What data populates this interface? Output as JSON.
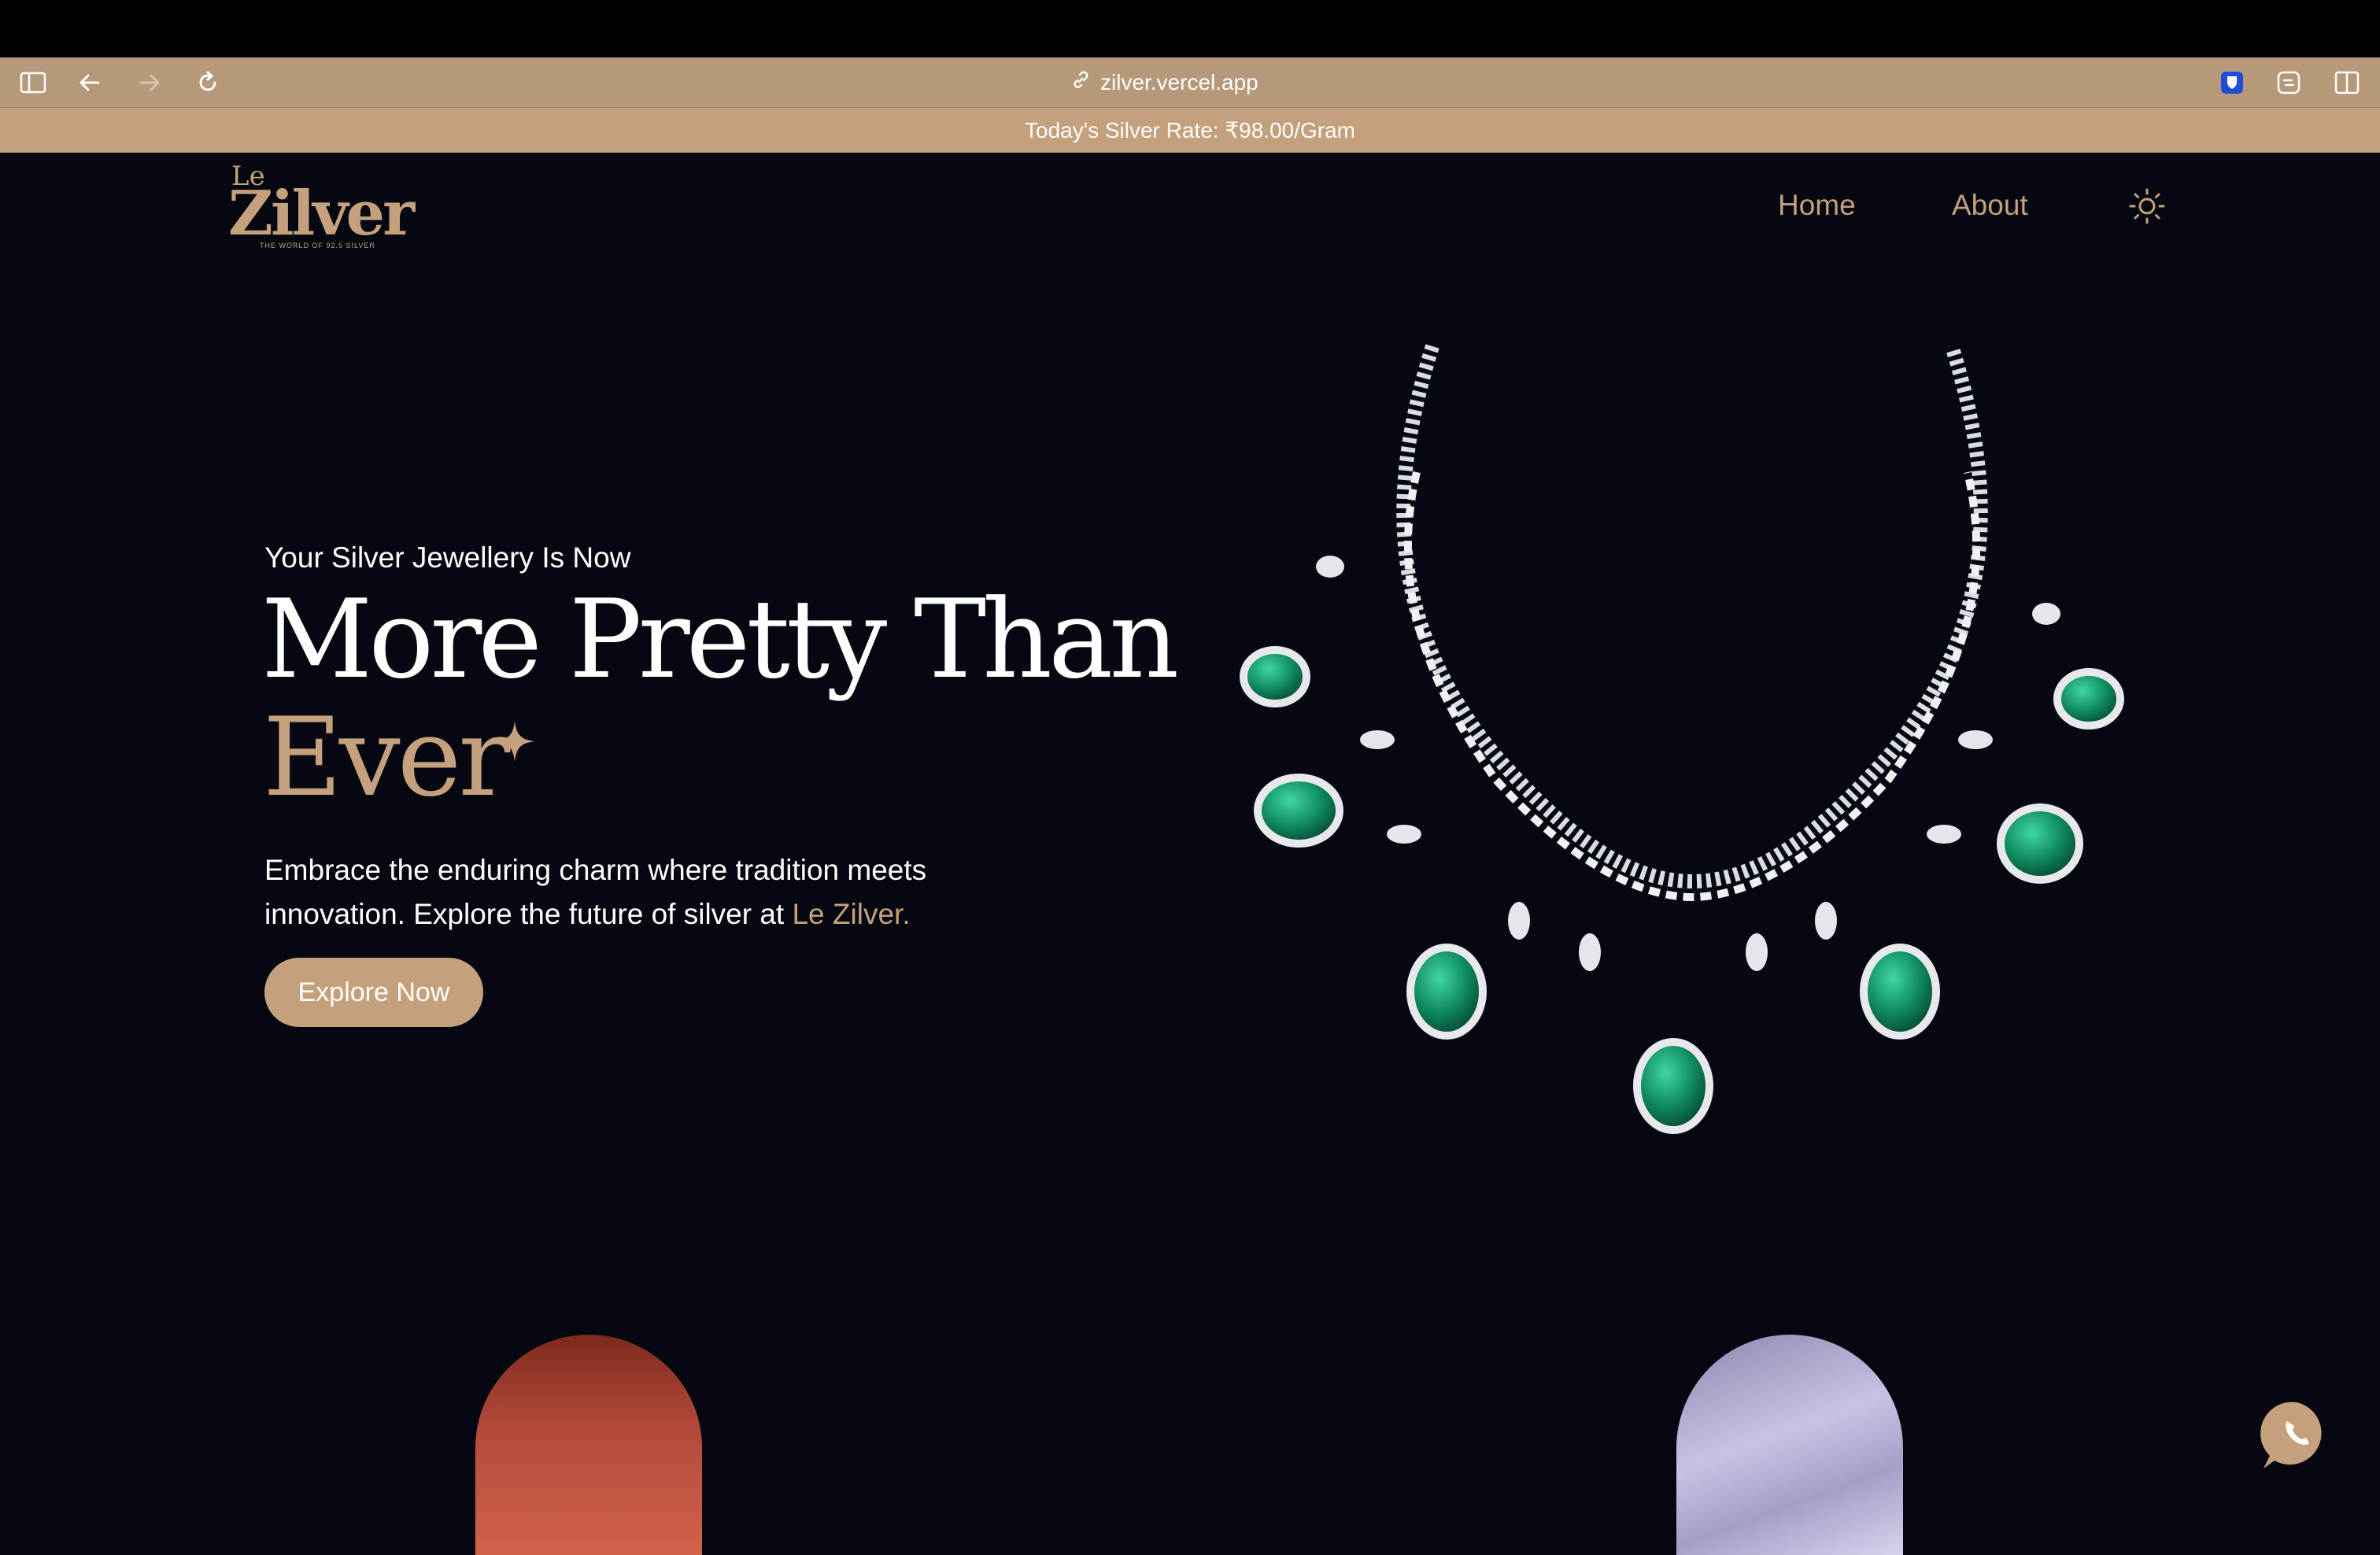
{
  "browser": {
    "url": "zilver.vercel.app"
  },
  "announcement": {
    "text": "Today's Silver Rate: ₹98.00/Gram"
  },
  "brand": {
    "logo_prefix": "Le",
    "logo_name": "Zilver",
    "tagline": "THE WORLD OF 92.5 SILVER"
  },
  "nav": {
    "items": [
      {
        "label": "Home"
      },
      {
        "label": "About"
      }
    ],
    "theme_icon": "sun-icon"
  },
  "hero": {
    "subtitle": "Your Silver Jewellery Is Now",
    "title_line1": "More Pretty Than",
    "title_line2": "Ever",
    "description": "Embrace the enduring charm where tradition meets innovation. Explore the future of silver at ",
    "description_accent": "Le Zilver.",
    "cta_label": "Explore Now"
  },
  "colors": {
    "accent": "#c5a07c",
    "background": "#050810",
    "browser_bar": "#b6997a",
    "emerald": "#0f8a5f"
  },
  "icons": [
    "sidebar-icon",
    "back-icon",
    "forward-icon",
    "reload-icon",
    "link-icon",
    "password-manager-icon",
    "extension-icon",
    "split-view-icon",
    "sparkle-icon",
    "whatsapp-icon"
  ]
}
